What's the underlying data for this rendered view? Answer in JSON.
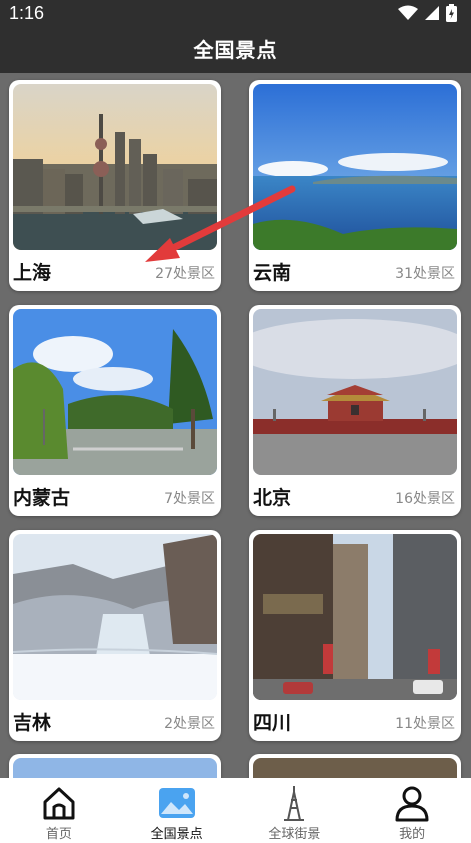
{
  "status_bar": {
    "time": "1:16"
  },
  "app_bar": {
    "title": "全国景点"
  },
  "regions": [
    {
      "name": "上海",
      "count": "27处景区"
    },
    {
      "name": "云南",
      "count": "31处景区"
    },
    {
      "name": "内蒙古",
      "count": "7处景区"
    },
    {
      "name": "北京",
      "count": "16处景区"
    },
    {
      "name": "吉林",
      "count": "2处景区"
    },
    {
      "name": "四川",
      "count": "11处景区"
    }
  ],
  "bottom_nav": [
    {
      "label": "首页",
      "icon": "home-icon"
    },
    {
      "label": "全国景点",
      "icon": "picture-icon",
      "active": true
    },
    {
      "label": "全球街景",
      "icon": "tower-icon"
    },
    {
      "label": "我的",
      "icon": "user-icon"
    }
  ],
  "colors": {
    "accent": "#4aa3f0",
    "annotation_arrow": "#e23b3b"
  }
}
